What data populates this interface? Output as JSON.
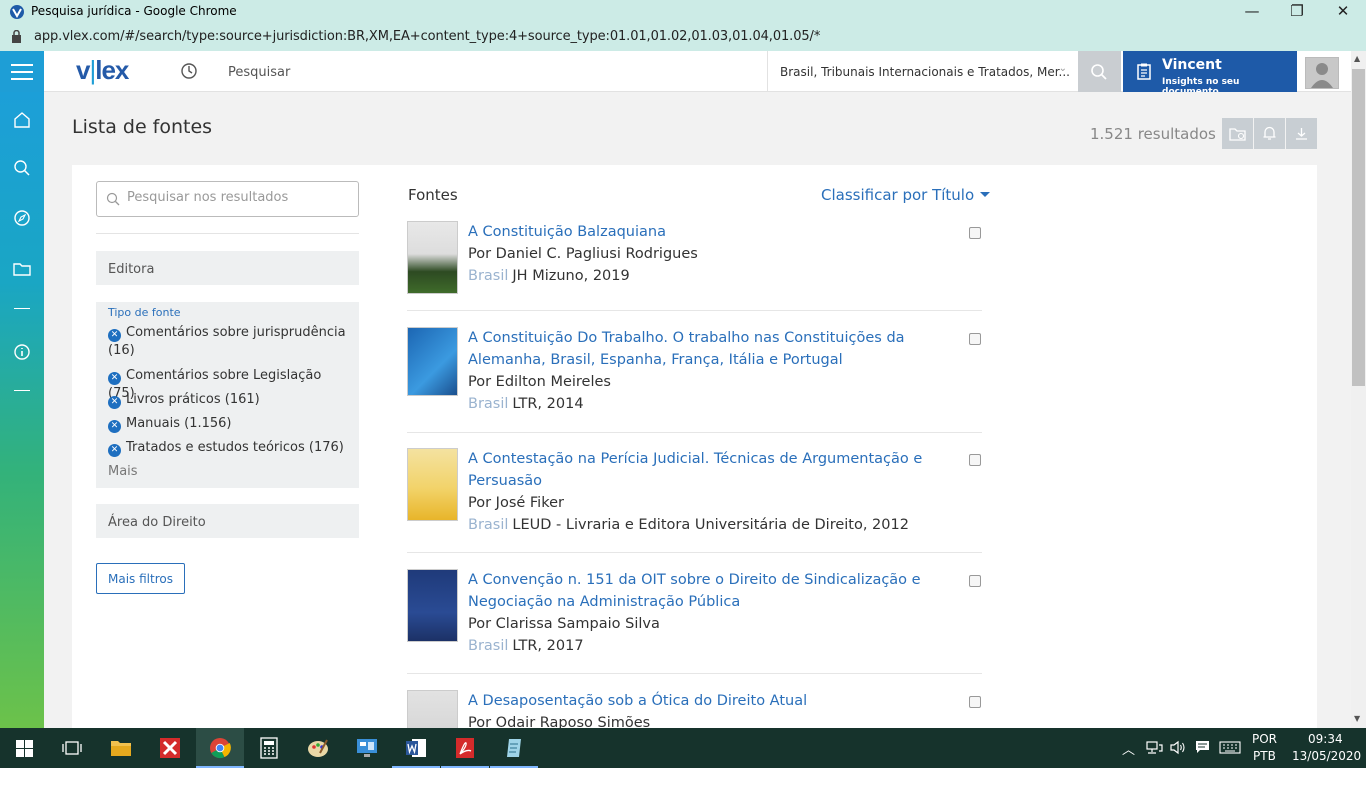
{
  "window": {
    "title": "Pesquisa jurídica - Google Chrome",
    "url": "app.vlex.com/#/search/type:source+jurisdiction:BR,XM,EA+content_type:4+source_type:01.01,01.02,01.03,01.04,01.05/*"
  },
  "header": {
    "logo_main": "v",
    "logo_bar": "|",
    "logo_rest": "lex",
    "search_placeholder": "Pesquisar",
    "jurisdiction": "Brasil, Tribunais Internacionais e Tratados, Mer...",
    "vincent_name": "Vincent",
    "vincent_sub": "Insights no seu documento"
  },
  "page": {
    "title": "Lista de fontes",
    "results_count": "1.521 resultados"
  },
  "sidebar": {
    "search_placeholder": "Pesquisar nos resultados",
    "facet_editora": "Editora",
    "facet_type_label": "Tipo de fonte",
    "facet_type_items": [
      "Comentários sobre jurisprudência (16)",
      "Comentários sobre Legislação (75)",
      "Livros práticos (161)",
      "Manuais (1.156)",
      "Tratados e estudos teóricos (176)"
    ],
    "facet_type_more": "Mais",
    "facet_area": "Área do Direito",
    "more_filters": "Mais filtros"
  },
  "list": {
    "label": "Fontes",
    "sort": "Classificar por Título",
    "results": [
      {
        "title": "A Constituição Balzaquiana",
        "author": "Por Daniel C. Pagliusi Rodrigues",
        "country": "Brasil",
        "publisher": "JH Mizuno, 2019"
      },
      {
        "title": "A Constituição Do Trabalho. O trabalho nas Constituições da Alemanha, Brasil, Espanha, França, Itália e Portugal",
        "author": "Por Edilton Meireles",
        "country": "Brasil",
        "publisher": "LTR, 2014"
      },
      {
        "title": "A Contestação na Perícia Judicial. Técnicas de Argumentação e Persuasão",
        "author": "Por José Fiker",
        "country": "Brasil",
        "publisher": "LEUD - Livraria e Editora Universitária de Direito, 2012"
      },
      {
        "title": "A Convenção n. 151 da OIT sobre o Direito de Sindicalização e Negociação na Administração Pública",
        "author": "Por Clarissa Sampaio Silva",
        "country": "Brasil",
        "publisher": "LTR, 2017"
      },
      {
        "title": "A Desaposentação sob a Ótica do Direito Atual",
        "author": "Por Odair Raposo Simões",
        "country": "",
        "publisher": ""
      }
    ]
  },
  "taskbar": {
    "lang_top": "POR",
    "lang_bottom": "PTB",
    "time": "09:34",
    "date": "13/05/2020"
  },
  "colors": {
    "accent": "#2a6fba",
    "vincent": "#1e5aa8",
    "chrome_bg": "#ccebe6",
    "taskbar": "#16332c"
  }
}
